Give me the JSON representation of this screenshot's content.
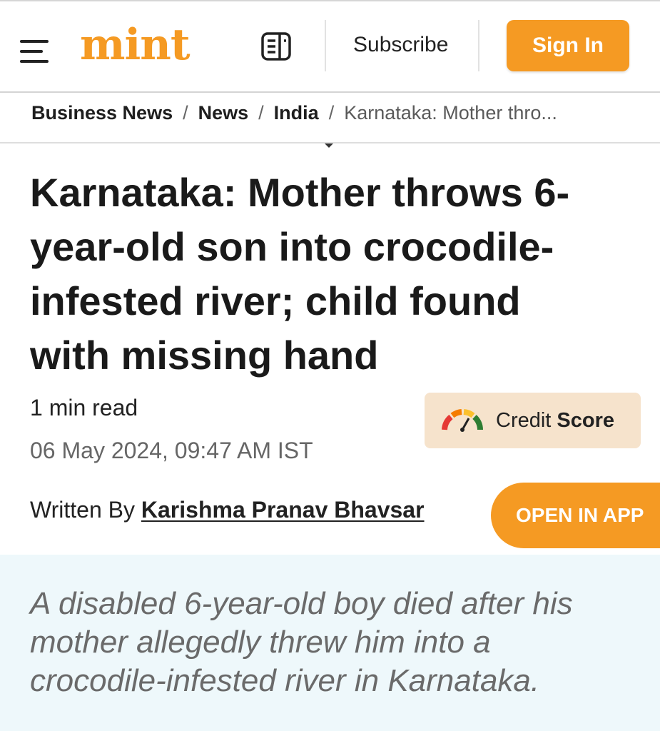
{
  "header": {
    "logo": "mint",
    "subscribe_label": "Subscribe",
    "signin_label": "Sign In",
    "icons": {
      "menu": "hamburger-menu-icon",
      "epaper": "newspaper-icon"
    },
    "accent_color": "#f59a23"
  },
  "breadcrumb": {
    "items": [
      "Business News",
      "News",
      "India"
    ],
    "separator": "/",
    "current": "Karnataka: Mother thro..."
  },
  "article": {
    "headline": "Karnataka: Mother throws 6-year-old son into crocodile-infested river; child found with missing hand",
    "read_time": "1 min read",
    "date": "06 May 2024, 09:47 AM IST",
    "written_by_label": "Written By",
    "author": "Karishma Pranav Bhavsar",
    "summary": "A disabled 6-year-old boy died after his mother allegedly threw him into a crocodile-infested river in Karnataka."
  },
  "ad": {
    "credit_label": "Credit",
    "score_label": "Score",
    "icon": "credit-score-gauge-icon"
  },
  "cta": {
    "open_in_app_label": "OPEN IN APP"
  }
}
